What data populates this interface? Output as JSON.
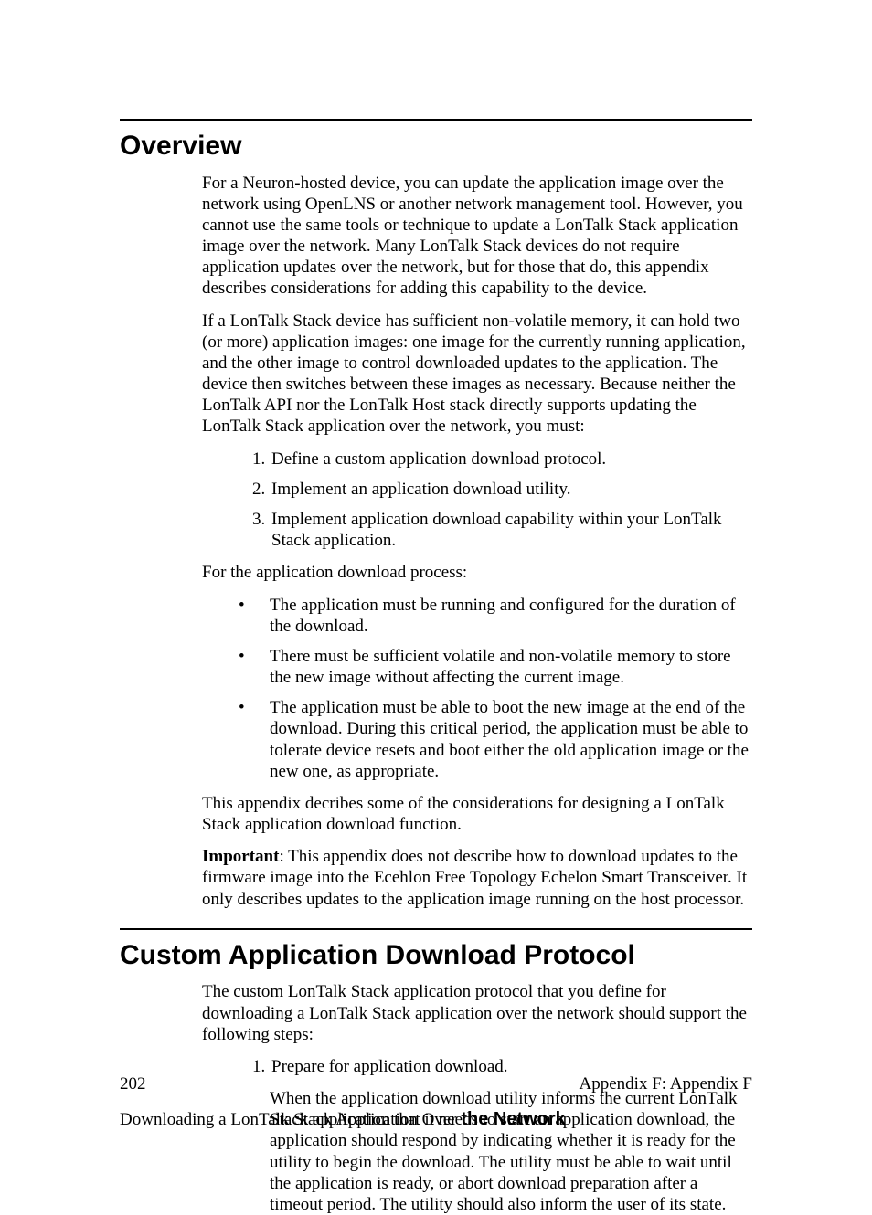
{
  "section1": {
    "title": "Overview",
    "p1": "For a Neuron-hosted device, you can update the application image over the network using OpenLNS or another network management tool.  However, you cannot use the same tools or technique to update a LonTalk Stack application image over the network.  Many LonTalk Stack devices do not require application updates over the network, but for those that do, this appendix describes considerations for adding this capability to the device.",
    "p2": "If a LonTalk Stack device has sufficient non-volatile memory, it can hold two (or more) application images:  one image for the currently running application, and the other image to control downloaded updates to the application.  The device then switches between these images as necessary.  Because neither the LonTalk API nor the LonTalk Host stack directly supports updating the LonTalk Stack application over the network, you must:",
    "ol1": [
      "Define a custom application download protocol.",
      "Implement an application download utility.",
      "Implement application download capability within your LonTalk Stack application."
    ],
    "p3": "For the application download process:",
    "ul1": [
      "The application must be running and configured for the duration of the download.",
      "There must be sufficient volatile and non-volatile memory to store the new image without affecting the current image.",
      "The application must be able to boot the new image at the end of the download.  During this critical period, the application must be able to tolerate device resets and boot either the old application image or the new one, as appropriate."
    ],
    "p4": "This appendix decribes some of the considerations for designing a LonTalk Stack application download function.",
    "important_label": "Important",
    "important_rest": ":  This appendix does not describe how to download updates to the firmware image into the Ecehlon Free Topology Echelon Smart Transceiver.  It only describes updates to the application image running on the host processor."
  },
  "section2": {
    "title": "Custom Application Download Protocol",
    "p1": "The custom LonTalk Stack application protocol that you define for downloading a LonTalk Stack application over the network should support the following steps:",
    "step1": "Prepare for application download.",
    "step1_detail": "When the application download utility informs the current LonTalk Stack application that it needs to start an application download, the application should respond by indicating whether it is ready for the utility to begin the download.  The utility must be able to wait until the application is ready, or abort download preparation after a timeout period.  The utility should also inform the user of its state."
  },
  "footer": {
    "page": "202",
    "right": "Appendix F: Appendix F",
    "bottom_pre": "Downloading a LonTalk Stack Application Over ",
    "bottom_bold": "the Network"
  }
}
